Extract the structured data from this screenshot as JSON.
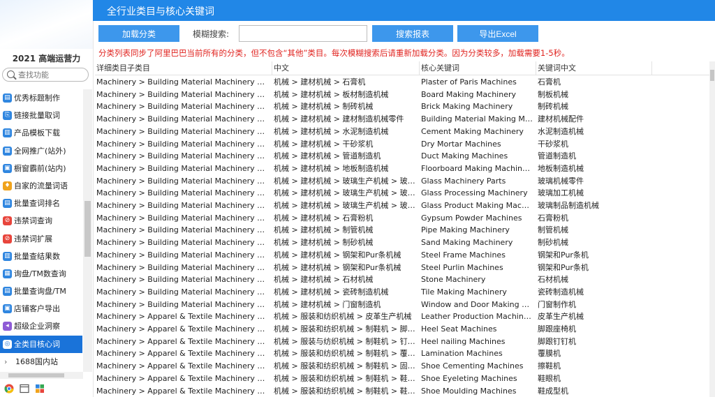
{
  "sidebar": {
    "title": "2021 高端运营力",
    "search_placeholder": "查找功能",
    "items": [
      {
        "label": "优秀标题制作",
        "color": "#2f86e0"
      },
      {
        "label": "链接批量取词",
        "color": "#2f86e0"
      },
      {
        "label": "产品模板下载",
        "color": "#2f86e0"
      },
      {
        "label": "全网推广(站外)",
        "color": "#2f86e0"
      },
      {
        "label": "橱窗霸前(站内)",
        "color": "#2f86e0"
      },
      {
        "label": "自家的流量词语",
        "color": "#f0a31c"
      },
      {
        "label": "批量查词排名",
        "color": "#2f86e0"
      },
      {
        "label": "违禁词查询",
        "color": "#e8453c"
      },
      {
        "label": "违禁词扩展",
        "color": "#e8453c"
      },
      {
        "label": "批量查结果数",
        "color": "#2f86e0"
      },
      {
        "label": "询盘/TM数查询",
        "color": "#2f86e0"
      },
      {
        "label": "批量查询盘/TM",
        "color": "#2f86e0"
      },
      {
        "label": "店铺客户导出",
        "color": "#2f86e0"
      },
      {
        "label": "超级企业洞察",
        "color": "#8e5bd6"
      },
      {
        "label": "全类目核心词",
        "color": "#2f86e0",
        "active": true
      },
      {
        "label": "1688国内站",
        "chevron": true
      }
    ]
  },
  "window": {
    "title": "全行业类目与核心关键词"
  },
  "toolbar": {
    "load_label": "加载分类",
    "search_label": "模糊搜索:",
    "search_value": "",
    "search_button": "搜索报表",
    "export_button": "导出Excel"
  },
  "notice": "分类列表同步了阿里巴巴当前所有的分类，但不包含“其他”类目。每次模糊搜索后请重新加载分类。因为分类较多，加载需要1-5秒。",
  "table": {
    "columns": [
      "详细类目子类目",
      "中文",
      "核心关键词",
      "关键词中文"
    ],
    "rows": [
      [
        "Machinery > Building Material Machinery > Plas…",
        "机械 > 建材机械 > 石膏机",
        "Plaster of Paris Machines",
        "石膏机"
      ],
      [
        "Machinery > Building Material Machinery > Boa…",
        "机械 > 建材机械 > 板材制造机械",
        "Board Making Machinery",
        "制板机械"
      ],
      [
        "Machinery > Building Material Machinery > Bric…",
        "机械 > 建材机械 > 制砖机械",
        "Brick Making Machinery",
        "制砖机械"
      ],
      [
        "Machinery > Building Material Machinery > Buil…",
        "机械 > 建材机械 > 建材制造机械零件",
        "Building Material Making Mac…",
        "建材机械配件"
      ],
      [
        "Machinery > Building Material Machinery > Cem…",
        "机械 > 建材机械 > 水泥制造机械",
        "Cement Making Machinery",
        "水泥制造机械"
      ],
      [
        "Machinery > Building Material Machinery > Dry …",
        "机械 > 建材机械 > 干砂浆机",
        "Dry Mortar Machines",
        "干砂浆机"
      ],
      [
        "Machinery > Building Material Machinery > Duct…",
        "机械 > 建材机械 > 管道制造机",
        "Duct Making Machines",
        "管道制造机"
      ],
      [
        "Machinery > Building Material Machinery > Floo…",
        "机械 > 建材机械 > 地板制造机械",
        "Floorboard Making Machinery",
        "地板制造机械"
      ],
      [
        "Machinery > Building Material Machinery > Glas…",
        "机械 > 建材机械 > 玻璃生产机械 > 玻璃…",
        "Glass Machinery Parts",
        "玻璃机械零件"
      ],
      [
        "Machinery > Building Material Machinery > Glas…",
        "机械 > 建材机械 > 玻璃生产机械 > 玻璃…",
        "Glass Processing Machinery",
        "玻璃加工机械"
      ],
      [
        "Machinery > Building Material Machinery > Glas…",
        "机械 > 建材机械 > 玻璃生产机械 > 玻璃…",
        "Glass Product Making Machin…",
        "玻璃制品制造机械"
      ],
      [
        "Machinery > Building Material Machinery > Gyp…",
        "机械 > 建材机械 > 石膏粉机",
        "Gypsum Powder Machines",
        "石膏粉机"
      ],
      [
        "Machinery > Building Material Machinery > Pipe…",
        "机械 > 建材机械 > 制管机械",
        "Pipe Making Machinery",
        "制管机械"
      ],
      [
        "Machinery > Building Material Machinery > San…",
        "机械 > 建材机械 > 制砂机械",
        "Sand Making Machinery",
        "制砂机械"
      ],
      [
        "Machinery > Building Material Machinery > Stee…",
        "机械 > 建材机械 > 钢架和Pur条机械",
        "Steel Frame Machines",
        "钢架和Pur条机"
      ],
      [
        "Machinery > Building Material Machinery > Stee…",
        "机械 > 建材机械 > 钢架和Pur条机械",
        "Steel Purlin Machines",
        "钢架和Pur条机"
      ],
      [
        "Machinery > Building Material Machinery > Ston…",
        "机械 > 建材机械 > 石材机械",
        "Stone Machinery",
        "石材机械"
      ],
      [
        "Machinery > Building Material Machinery > Tile …",
        "机械 > 建材机械 > 瓷砖制造机械",
        "Tile Making Machinery",
        "瓷砖制造机械"
      ],
      [
        "Machinery > Building Material Machinery > Win…",
        "机械 > 建材机械 > 门窗制造机",
        "Window and Door Making Ma…",
        "门窗制作机"
      ],
      [
        "Machinery > Apparel & Textile Machinery > Leat…",
        "机械 > 服装和纺织机械 > 皮革生产机械",
        "Leather Production Machinery",
        "皮革生产机械"
      ],
      [
        "Machinery > Apparel & Textile Machinery > Sho…",
        "机械 > 服装和纺织机械 > 制鞋机 > 脚跟…",
        "Heel Seat Machines",
        "脚跟座椅机"
      ],
      [
        "Machinery > Apparel & Textile Machinery > Sho…",
        "机械 > 服装与纺织机械 > 制鞋机 > 钉鞋机",
        "Heel nailing Machines",
        "脚跟钉钉机"
      ],
      [
        "Machinery > Apparel & Textile Machinery > Sho…",
        "机械 > 服装和纺织机械 > 制鞋机 > 覆膜机",
        "Lamination Machines",
        "覆膜机"
      ],
      [
        "Machinery > Apparel & Textile Machinery > Sho…",
        "机械 > 服装和纺织机械 > 制鞋机 > 固井机",
        "Shoe Cementing Machines",
        "擦鞋机"
      ],
      [
        "Machinery > Apparel & Textile Machinery > Sho…",
        "机械 > 服装和纺织机械 > 制鞋机 > 鞋孔…",
        "Shoe Eyeleting Machines",
        "鞋眼机"
      ],
      [
        "Machinery > Apparel & Textile Machinery > Sho…",
        "机械 > 服装和纺织机械 > 制鞋机 > 鞋…",
        "Shoe Moulding Machines",
        "鞋成型机"
      ]
    ]
  }
}
